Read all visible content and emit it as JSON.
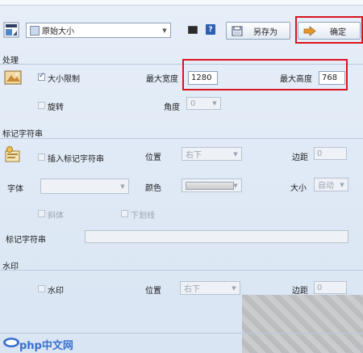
{
  "toolbar": {
    "preset": "原始大小",
    "save_as": "另存为",
    "confirm": "确定"
  },
  "processing": {
    "title": "处理",
    "limit_size": "大小限制",
    "limit_size_checked": true,
    "max_width_label": "最大宽度",
    "max_width": "1280",
    "max_height_label": "最大高度",
    "max_height": "768",
    "rotate": "旋转",
    "angle_label": "角度",
    "angle": "0"
  },
  "marker": {
    "title": "标记字符串",
    "insert": "插入标记字符串",
    "position_label": "位置",
    "position": "右下",
    "margin_label": "边距",
    "margin": "0",
    "font_label": "字体",
    "color_label": "颜色",
    "size_label": "大小",
    "size": "自动",
    "italic": "斜体",
    "underline": "下划线",
    "string_label": "标记字符串"
  },
  "watermark": {
    "title": "水印",
    "enable": "水印",
    "position_label": "位置",
    "position": "右下",
    "margin_label": "边距",
    "margin": "0"
  },
  "site_watermark": "php中文网"
}
